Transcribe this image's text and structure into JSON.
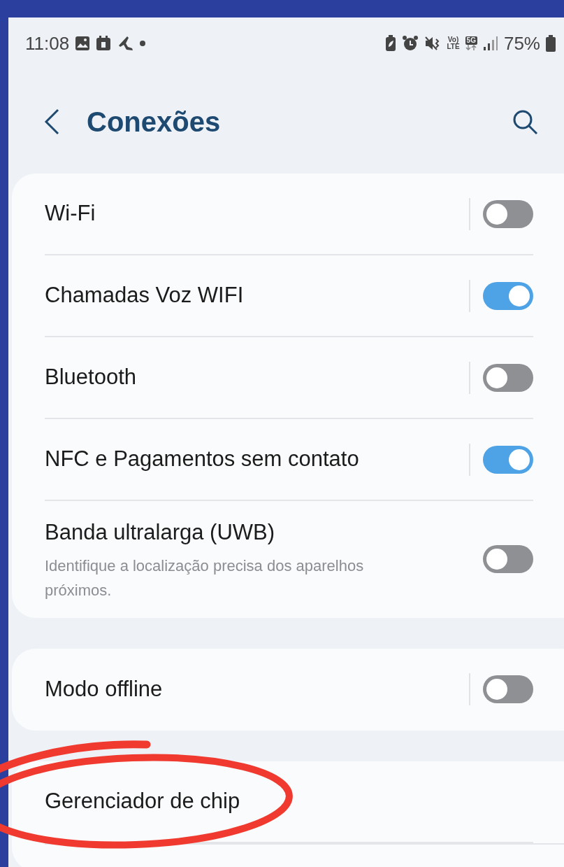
{
  "status_bar": {
    "time": "11:08",
    "volte_top": "Vo)",
    "volte_bottom": "LTE",
    "network": "5G",
    "battery": "75%"
  },
  "header": {
    "title": "Conexões"
  },
  "groups": [
    {
      "items": [
        {
          "label": "Wi-Fi",
          "kind": "toggle",
          "on": false
        },
        {
          "label": "Chamadas Voz WIFI",
          "kind": "toggle",
          "on": true
        },
        {
          "label": "Bluetooth",
          "kind": "toggle",
          "on": false
        },
        {
          "label": "NFC e Pagamentos sem contato",
          "kind": "toggle",
          "on": true
        },
        {
          "label": "Banda ultralarga (UWB)",
          "description": "Identifique a localização precisa dos aparelhos próximos.",
          "kind": "toggle",
          "on": false
        }
      ]
    },
    {
      "items": [
        {
          "label": "Modo offline",
          "kind": "toggle",
          "on": false
        }
      ]
    },
    {
      "items": [
        {
          "label": "Gerenciador de chip",
          "kind": "link"
        }
      ]
    }
  ]
}
